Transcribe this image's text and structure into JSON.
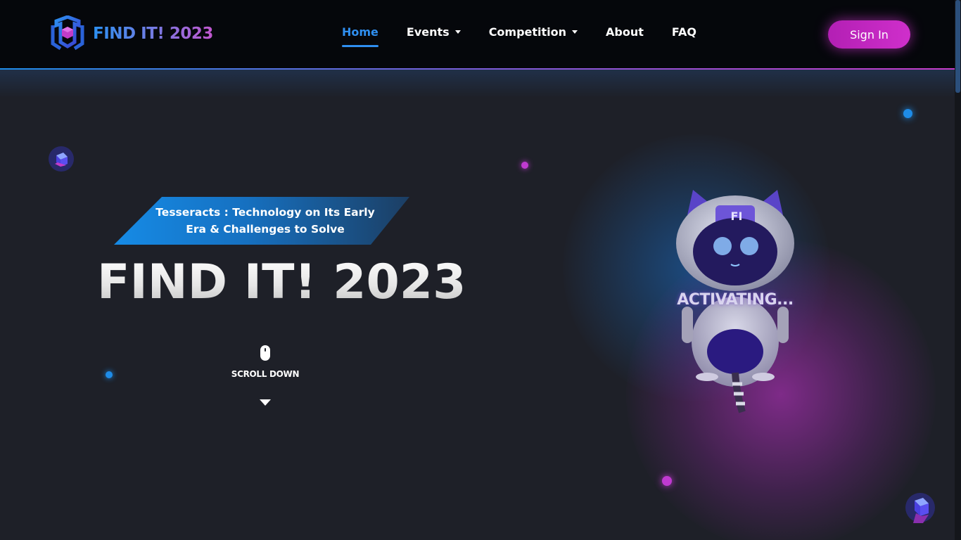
{
  "brand": {
    "name": "FIND IT! 2023",
    "logo_icon": "cube-logo-icon"
  },
  "nav": {
    "items": [
      {
        "label": "Home",
        "active": true,
        "dropdown": false
      },
      {
        "label": "Events",
        "active": false,
        "dropdown": true
      },
      {
        "label": "Competition",
        "active": false,
        "dropdown": true
      },
      {
        "label": "About",
        "active": false,
        "dropdown": false
      },
      {
        "label": "FAQ",
        "active": false,
        "dropdown": false
      }
    ],
    "signin_label": "Sign In"
  },
  "hero": {
    "tagline": "Tesseracts : Technology on Its Early Era & Challenges to Solve",
    "title": "FIND IT! 2023",
    "scroll_label": "SCROLL DOWN",
    "mascot_status": "ACTIVATING...",
    "mascot_badge": "FI"
  },
  "colors": {
    "accent_blue": "#2f8ff0",
    "accent_magenta": "#cf2fcb",
    "nav_bg": "#05070b",
    "page_bg": "#1e2028"
  }
}
